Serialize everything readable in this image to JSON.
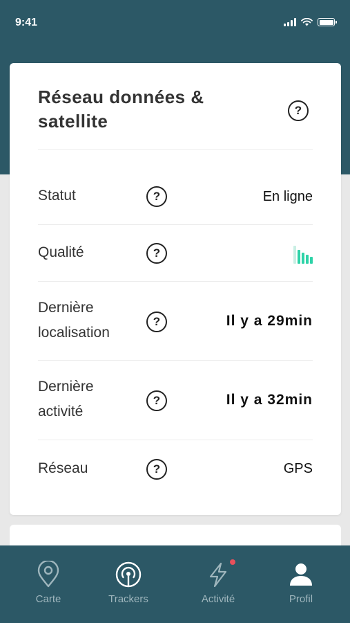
{
  "status_bar": {
    "time": "9:41",
    "icons": [
      "signal-icon",
      "wifi-icon",
      "battery-icon"
    ]
  },
  "card": {
    "title": "Réseau données & satellite",
    "help_glyph": "?",
    "rows": [
      {
        "label": "Statut",
        "value": "En ligne"
      },
      {
        "label": "Qualité",
        "quality_level": 0.8,
        "quality_bars": 5,
        "quality_color": "#2ed3a8"
      },
      {
        "label_line1": "Dernière",
        "label_line2": "localisation",
        "value": "Il y a 29min"
      },
      {
        "label_line1": "Dernière",
        "label_line2": "activité",
        "value": "Il y a 32min"
      },
      {
        "label": "Réseau",
        "value": "GPS"
      }
    ]
  },
  "tabbar": {
    "tabs": [
      {
        "label": "Carte",
        "icon": "map-pin-icon",
        "active": false
      },
      {
        "label": "Trackers",
        "icon": "tracker-icon",
        "active": true
      },
      {
        "label": "Activité",
        "icon": "lightning-icon",
        "active": false,
        "badge": true
      },
      {
        "label": "Profil",
        "icon": "user-icon",
        "active": false
      }
    ]
  },
  "colors": {
    "header": "#2c5866",
    "accent": "#2ed3a8",
    "badge": "#e8505b",
    "background": "#e8e8e8"
  }
}
